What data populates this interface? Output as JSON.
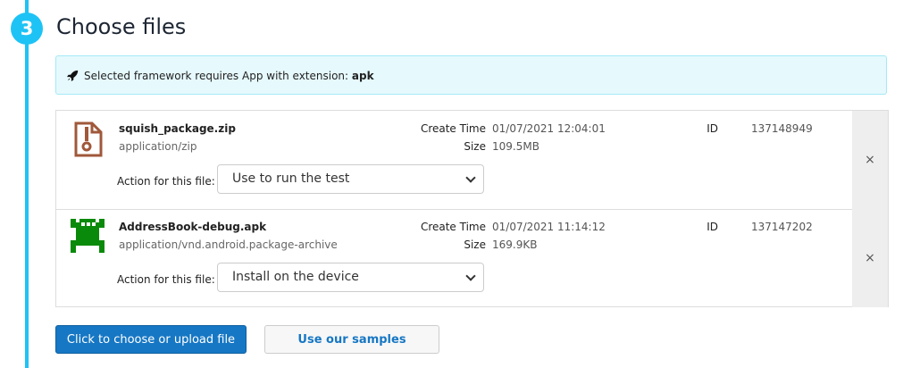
{
  "step": {
    "number": "3",
    "title": "Choose files"
  },
  "alert": {
    "text": "Selected framework requires App with extension: ",
    "extension": "apk"
  },
  "labels": {
    "create_time": "Create Time",
    "size": "Size",
    "id": "ID",
    "action": "Action for this file:",
    "remove": "×"
  },
  "files": [
    {
      "name": "squish_package.zip",
      "mime": "application/zip",
      "create_time": "01/07/2021 12:04:01",
      "size": "109.5MB",
      "id": "137148949",
      "action": "Use to run the test"
    },
    {
      "name": "AddressBook-debug.apk",
      "mime": "application/vnd.android.package-archive",
      "create_time": "01/07/2021 11:14:12",
      "size": "169.9KB",
      "id": "137147202",
      "action": "Install on the device"
    }
  ],
  "buttons": {
    "upload": "Click to choose or upload file",
    "samples": "Use our samples"
  }
}
